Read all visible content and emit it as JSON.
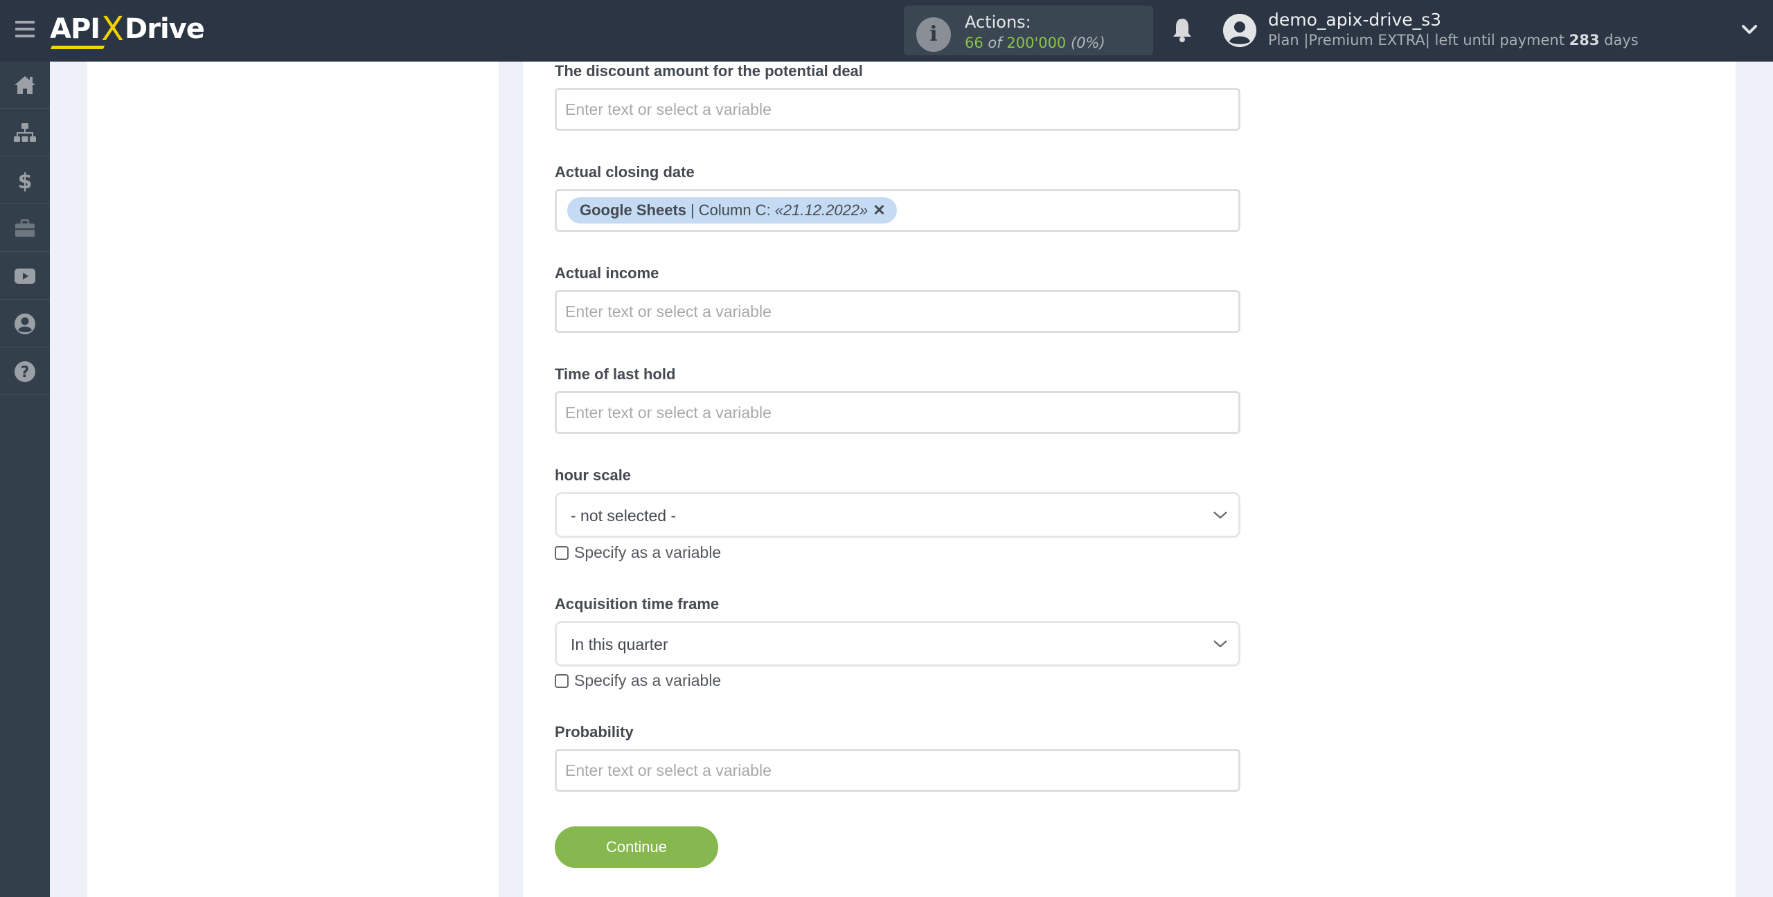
{
  "header": {
    "logo": {
      "api": "API",
      "x": "X",
      "drive": "Drive"
    },
    "actions": {
      "label": "Actions:",
      "used": "66",
      "of": "of",
      "total": "200'000",
      "percent": "(0%)"
    },
    "user": {
      "name": "demo_apix-drive_s3",
      "plan_prefix": "Plan |Premium EXTRA| left until payment",
      "days_left": "283",
      "days_suffix": "days"
    }
  },
  "sidebar": {
    "items": [
      {
        "name": "home",
        "icon": "home-icon"
      },
      {
        "name": "connections",
        "icon": "sitemap-icon"
      },
      {
        "name": "billing",
        "icon": "dollar-icon"
      },
      {
        "name": "tools",
        "icon": "briefcase-icon"
      },
      {
        "name": "videos",
        "icon": "youtube-icon"
      },
      {
        "name": "account",
        "icon": "user-circle-icon"
      },
      {
        "name": "help",
        "icon": "question-circle-icon"
      }
    ]
  },
  "form": {
    "placeholder": "Enter text or select a variable",
    "fields": {
      "discount": {
        "label": "The discount amount for the potential deal",
        "value": ""
      },
      "closing_date": {
        "label": "Actual closing date",
        "tag": {
          "source": "Google Sheets",
          "separator": "|",
          "column": "Column C:",
          "value": "«21.12.2022»",
          "remove": "✕"
        }
      },
      "actual_income": {
        "label": "Actual income",
        "value": ""
      },
      "last_hold": {
        "label": "Time of last hold",
        "value": ""
      },
      "hour_scale": {
        "label": "hour scale",
        "selected": "- not selected -",
        "checkbox_label": "Specify as a variable",
        "checked": false
      },
      "acquisition": {
        "label": "Acquisition time frame",
        "selected": "In this quarter",
        "checkbox_label": "Specify as a variable",
        "checked": false
      },
      "probability": {
        "label": "Probability",
        "value": ""
      }
    },
    "continue_label": "Continue"
  },
  "colors": {
    "header_bg": "#2b3543",
    "sidebar_bg": "#343f4c",
    "accent_green": "#86b84f",
    "logo_yellow": "#f2d200",
    "tag_bg": "#c5dbf3"
  }
}
